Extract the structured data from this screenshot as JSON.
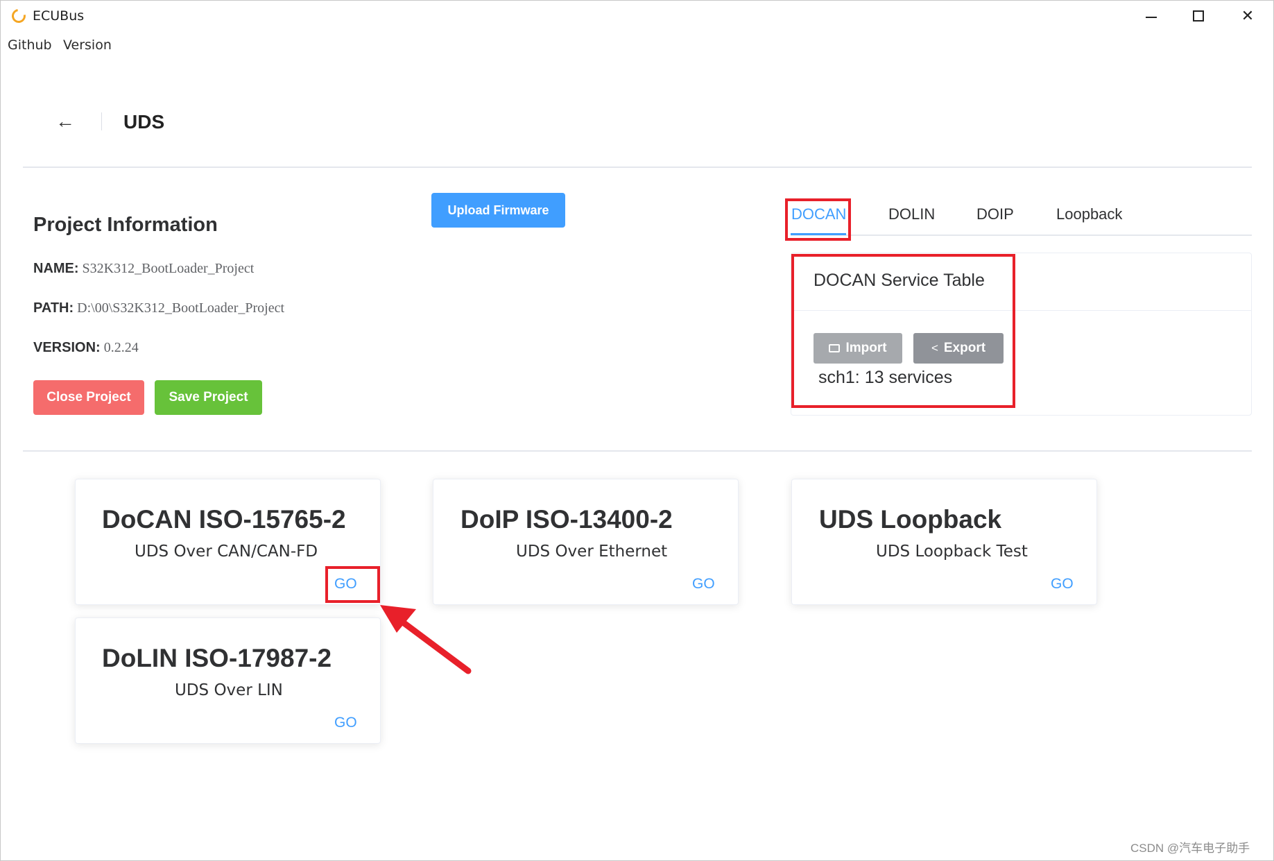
{
  "window": {
    "title": "ECUBus"
  },
  "menu": {
    "items": [
      "Github",
      "Version"
    ]
  },
  "header": {
    "back_icon": "arrow-left-icon",
    "title": "UDS"
  },
  "project": {
    "heading": "Project Information",
    "name_label": "NAME:",
    "name_value": "S32K312_BootLoader_Project",
    "path_label": "PATH:",
    "path_value": "D:\\00\\S32K312_BootLoader_Project",
    "version_label": "VERSION:",
    "version_value": "0.2.24",
    "close_label": "Close Project",
    "save_label": "Save Project",
    "upload_label": "Upload Firmware"
  },
  "tabs": {
    "items": [
      "DOCAN",
      "DOLIN",
      "DOIP",
      "Loopback"
    ],
    "active": "DOCAN"
  },
  "service_table": {
    "title": "DOCAN Service Table",
    "import_label": "Import",
    "export_label": "Export",
    "summary": "sch1: 13 services"
  },
  "cards": [
    {
      "title": "DoCAN ISO-15765-2",
      "subtitle": "UDS Over CAN/CAN-FD",
      "go": "GO"
    },
    {
      "title": "DoIP ISO-13400-2",
      "subtitle": "UDS Over Ethernet",
      "go": "GO"
    },
    {
      "title": "UDS Loopback",
      "subtitle": "UDS Loopback Test",
      "go": "GO"
    },
    {
      "title": "DoLIN ISO-17987-2",
      "subtitle": "UDS Over LIN",
      "go": "GO"
    }
  ],
  "colors": {
    "primary": "#409eff",
    "danger": "#f56c6c",
    "success": "#67c23a",
    "annotation": "#e8202a"
  },
  "watermark": "CSDN @汽车电子助手"
}
